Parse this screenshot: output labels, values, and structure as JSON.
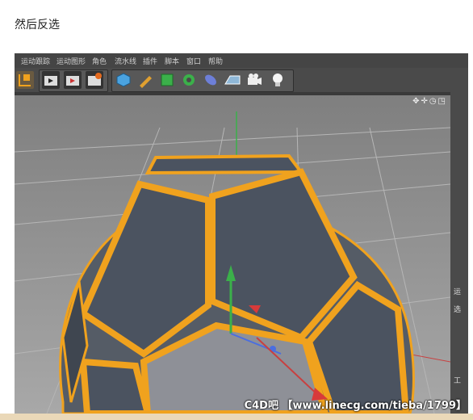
{
  "caption": "然后反选",
  "menu": [
    "运动跟踪",
    "运动图形",
    "角色",
    "流水线",
    "插件",
    "脚本",
    "窗口",
    "帮助"
  ],
  "viewport": {
    "nav_icons": "✥✛◷◳"
  },
  "right_panel": {
    "tab1": "运",
    "tab2": "选",
    "tab3": "工"
  },
  "watermark": "C4D吧 【www.linecg.com/tieba/1799】",
  "colors": {
    "accent": "#f0a21e",
    "face": "#4b5360",
    "viewport_bg": "#9c9c9c"
  }
}
